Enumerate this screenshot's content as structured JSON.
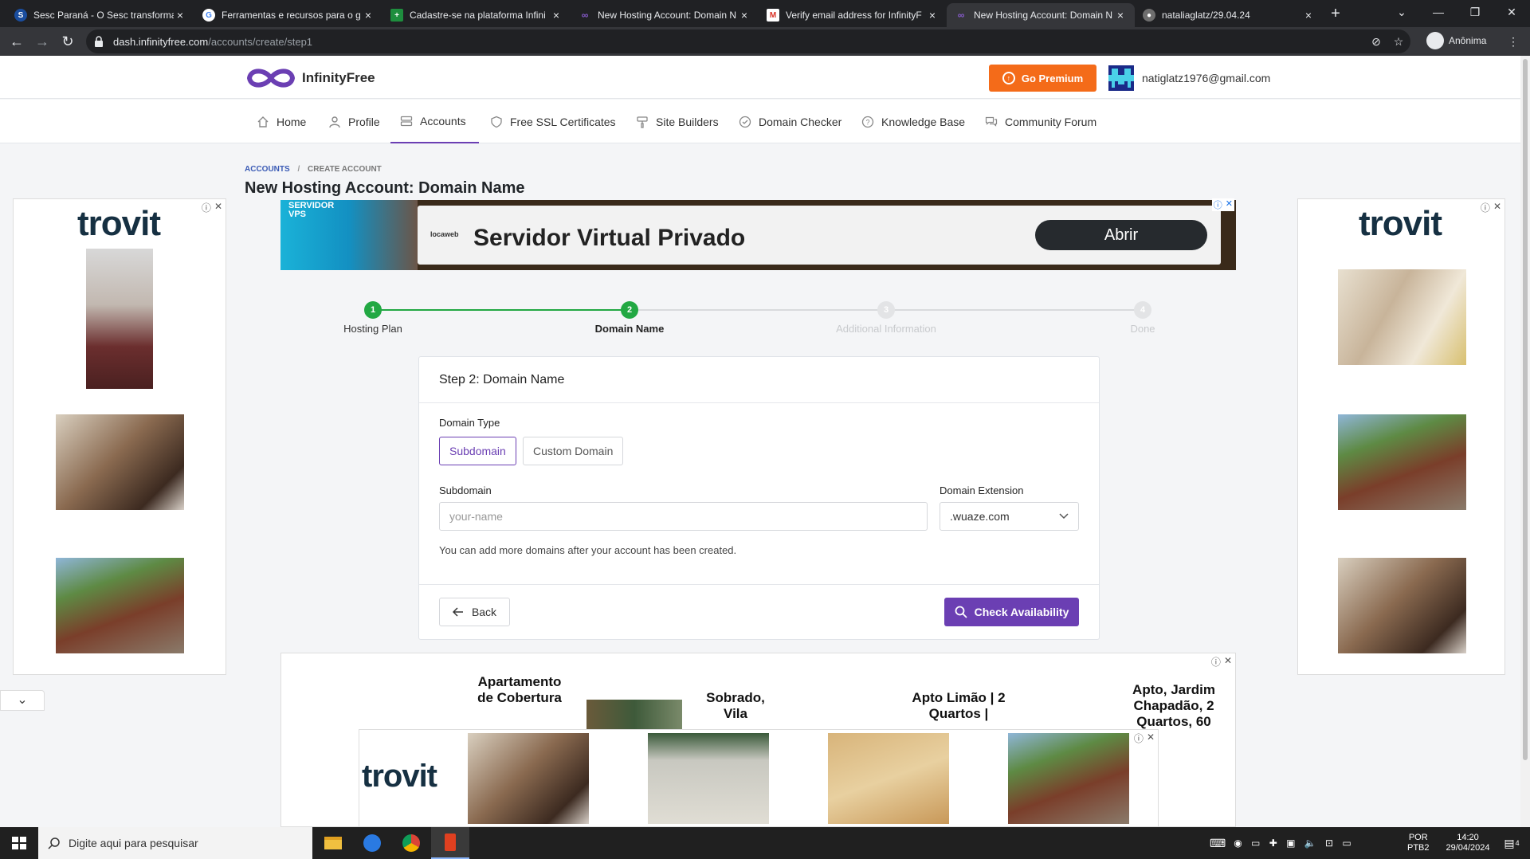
{
  "browser": {
    "tabs": [
      {
        "title": "Sesc Paraná - O Sesc transforma",
        "favicon": "sesc-icon"
      },
      {
        "title": "Ferramentas e recursos para o g",
        "favicon": "google-icon"
      },
      {
        "title": "Cadastre-se na plataforma Infini",
        "favicon": "sheet-icon"
      },
      {
        "title": "New Hosting Account: Domain N",
        "favicon": "infinityfree-icon"
      },
      {
        "title": "Verify email address for InfinityF",
        "favicon": "gmail-icon"
      },
      {
        "title": "New Hosting Account: Domain N",
        "favicon": "infinityfree-icon"
      },
      {
        "title": "nataliaglatz/29.04.24",
        "favicon": "github-icon"
      }
    ],
    "url_domain": "dash.infinityfree.com",
    "url_path": "/accounts/create/step1",
    "profile_label": "Anônima"
  },
  "header": {
    "logo_text": "InfinityFree",
    "premium_label": "Go Premium",
    "user_email": "natiglatz1976@gmail.com"
  },
  "nav": [
    {
      "label": "Home",
      "icon": "home-icon"
    },
    {
      "label": "Profile",
      "icon": "user-icon"
    },
    {
      "label": "Accounts",
      "icon": "server-icon"
    },
    {
      "label": "Free SSL Certificates",
      "icon": "shield-icon"
    },
    {
      "label": "Site Builders",
      "icon": "brush-icon"
    },
    {
      "label": "Domain Checker",
      "icon": "check-circle-icon"
    },
    {
      "label": "Knowledge Base",
      "icon": "help-icon"
    },
    {
      "label": "Community Forum",
      "icon": "chat-icon"
    }
  ],
  "breadcrumb": {
    "first": "Accounts",
    "second": "Create Account"
  },
  "page_title": "New Hosting Account: Domain Name",
  "banner_ad": {
    "left_text": "SERVIDOR VPS",
    "brand": "locaweb",
    "headline": "Servidor Virtual Privado",
    "cta": "Abrir"
  },
  "stepper": {
    "steps": [
      {
        "number": "1",
        "label": "Hosting Plan",
        "state": "complete"
      },
      {
        "number": "2",
        "label": "Domain Name",
        "state": "current"
      },
      {
        "number": "3",
        "label": "Additional Information",
        "state": "pending"
      },
      {
        "number": "4",
        "label": "Done",
        "state": "pending"
      }
    ]
  },
  "form": {
    "card_title": "Step 2: Domain Name",
    "domain_type_label": "Domain Type",
    "subdomain_option": "Subdomain",
    "custom_domain_option": "Custom Domain",
    "subdomain_label": "Subdomain",
    "subdomain_placeholder": "your-name",
    "extension_label": "Domain Extension",
    "extension_value": ".wuaze.com",
    "hint": "You can add more domains after your account has been created.",
    "back_label": "Back",
    "check_label": "Check Availability"
  },
  "ads": {
    "trovit_logo": "trovit",
    "listing_titles": [
      "Apartamento de Cobertura",
      "Sobrado, Vila",
      "Apto Limão | 2 Quartos |",
      "Apto, Jardim Chapadão, 2 Quartos, 60"
    ]
  },
  "taskbar": {
    "search_placeholder": "Digite aqui para pesquisar",
    "lang": "POR",
    "layout": "PTB2",
    "time": "14:20",
    "date": "29/04/2024",
    "notifications": "4"
  },
  "colors": {
    "accent": "#6b3fb3",
    "premium": "#f46b19",
    "step_done": "#22a843"
  }
}
